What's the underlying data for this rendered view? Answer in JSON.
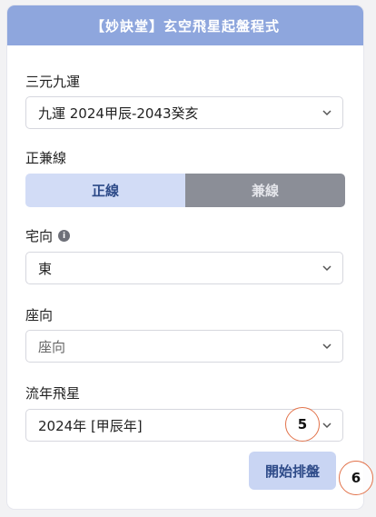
{
  "header": {
    "title": "【妙訣堂】玄空飛星起盤程式"
  },
  "fields": {
    "yun": {
      "label": "三元九運",
      "value": "九運 2024甲辰-2043癸亥"
    },
    "mode": {
      "label": "正兼線",
      "options": [
        "正線",
        "兼線"
      ],
      "selected": "正線"
    },
    "zhai": {
      "label": "宅向",
      "value": "東",
      "info_icon": "info-icon"
    },
    "zuo": {
      "label": "座向",
      "placeholder": "座向"
    },
    "liunian": {
      "label": "流年飛星",
      "value": "2024年 [甲辰年]"
    }
  },
  "actions": {
    "start_label": "開始排盤"
  },
  "markers": {
    "m5": "5",
    "m6": "6"
  },
  "colors": {
    "header": "#8ea6dd",
    "accent": "#2d4a88",
    "marker": "#e2734b"
  }
}
